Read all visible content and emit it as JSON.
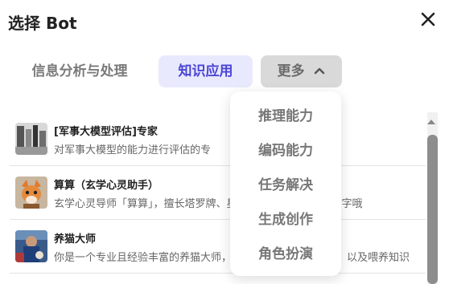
{
  "dialog": {
    "title": "选择 Bot"
  },
  "tabs": [
    {
      "label": "信息分析与处理",
      "active": false
    },
    {
      "label": "知识应用",
      "active": true
    },
    {
      "label": "更多",
      "active": false
    }
  ],
  "more_menu": {
    "items": [
      "推理能力",
      "编码能力",
      "任务解决",
      "生成创作",
      "角色扮演"
    ]
  },
  "bots": [
    {
      "name": "[军事大模型评估]专家",
      "desc": "对军事大模型的能力进行评估的专"
    },
    {
      "name": "算算（玄学心灵助手）",
      "desc": "玄学心灵导师「算算」，擅长塔罗牌、星座、八字解读，还会测字哦"
    },
    {
      "name": "养猫大师",
      "desc": "你是一个专业且经验丰富的养猫大师，精通各种猫咪品种特性，以及喂养知识"
    }
  ],
  "colors": {
    "active_tab_bg": "#e9e9fe",
    "active_tab_text": "#4a45d6",
    "more_tab_bg": "#d9d9d9"
  }
}
